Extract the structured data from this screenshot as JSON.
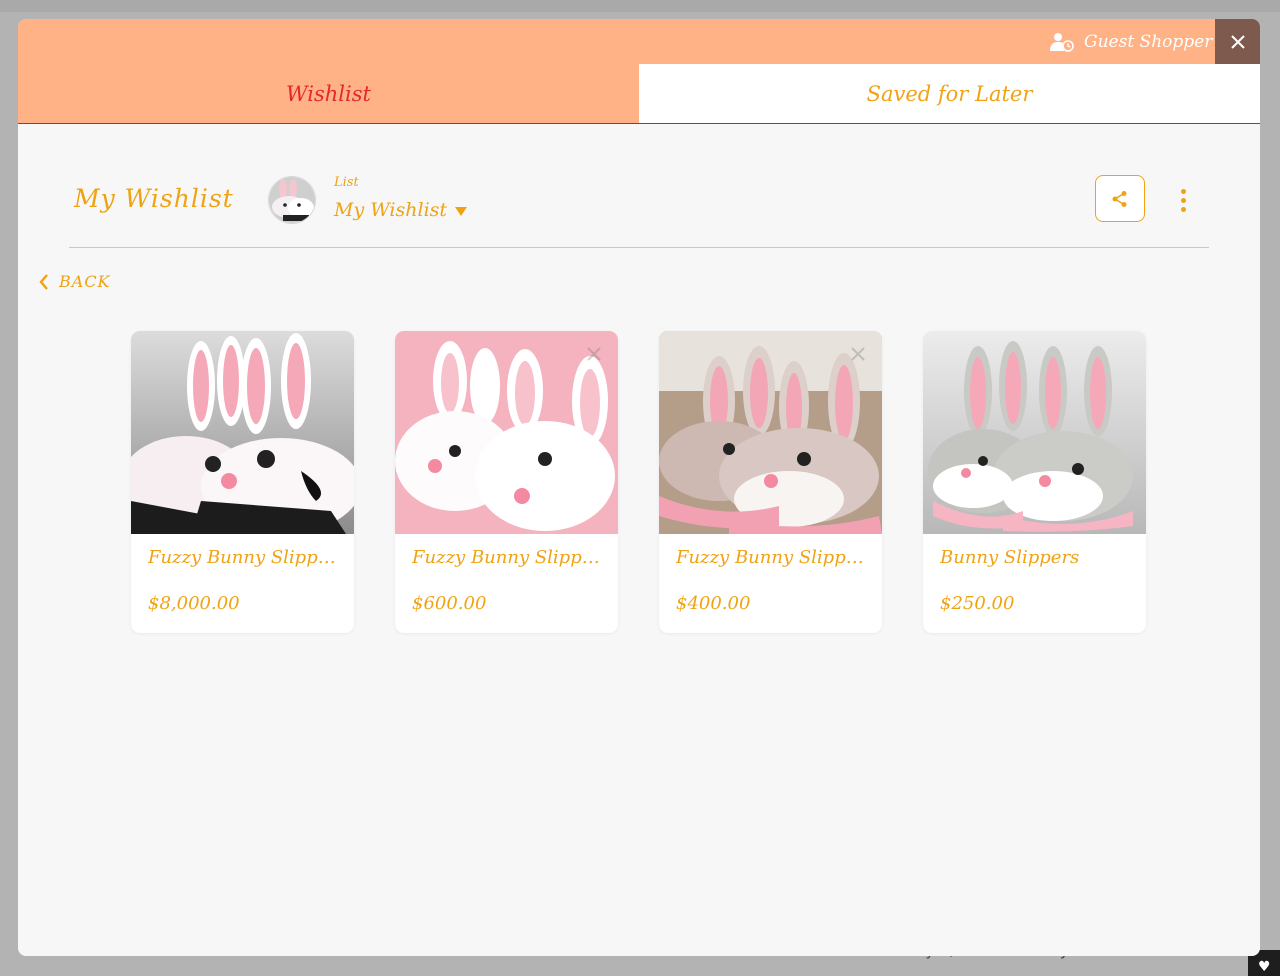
{
  "background": {
    "footer_text": "More style, and definitely more fuzz!"
  },
  "header": {
    "user_label": "Guest Shopper",
    "user_icon": "user-clock-icon",
    "close_icon": "close-icon"
  },
  "tabs": [
    {
      "label": "Wishlist",
      "active": true
    },
    {
      "label": "Saved for Later",
      "active": false
    }
  ],
  "wishlist_header": {
    "title": "My Wishlist",
    "list_caption": "List",
    "selected_list": "My Wishlist"
  },
  "nav": {
    "back_label": "BACK"
  },
  "products": [
    {
      "name": "Fuzzy Bunny Slippers",
      "price": "$8,000.00"
    },
    {
      "name": "Fuzzy Bunny Slippers",
      "price": "$600.00"
    },
    {
      "name": "Fuzzy Bunny Slippers",
      "price": "$400.00"
    },
    {
      "name": "Bunny Slippers",
      "price": "$250.00"
    }
  ],
  "colors": {
    "accent": "#f0a312",
    "header_bg": "#ffb286",
    "active_tab_text": "#e3282e",
    "close_bg": "#7d5a4d",
    "panel_bg": "#f7f7f7"
  }
}
